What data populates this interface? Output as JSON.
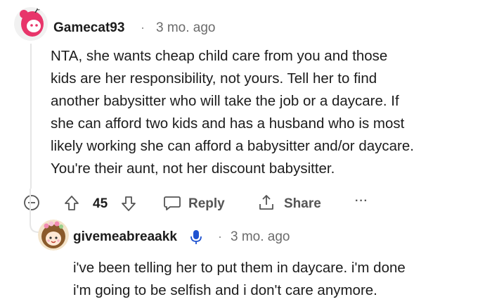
{
  "comment": {
    "username": "Gamecat93",
    "separator": "·",
    "time": "3 mo. ago",
    "lines": [
      "NTA, she wants cheap child care from you and those",
      "kids are her responsibility, not yours. Tell her to find",
      "another babysitter who will take the job or a daycare. If",
      "she can afford two kids and has a husband who is most",
      "likely working she can afford a babysitter and/or daycare.",
      "You're their aunt, not her discount babysitter."
    ],
    "actions": {
      "vote_count": "45",
      "reply_label": "Reply",
      "share_label": "Share",
      "more_label": "···"
    }
  },
  "reply": {
    "username": "givemeabreaakk",
    "separator": "·",
    "time": "3 mo. ago",
    "lines": [
      "i've been telling her to put them in daycare. i'm done",
      "i'm going to be selfish and i don't care anymore."
    ]
  },
  "colors": {
    "avatar1_bg": "#e8356a",
    "avatar2_bg": "#f3e3c9",
    "mic_icon": "#1f53d1"
  }
}
